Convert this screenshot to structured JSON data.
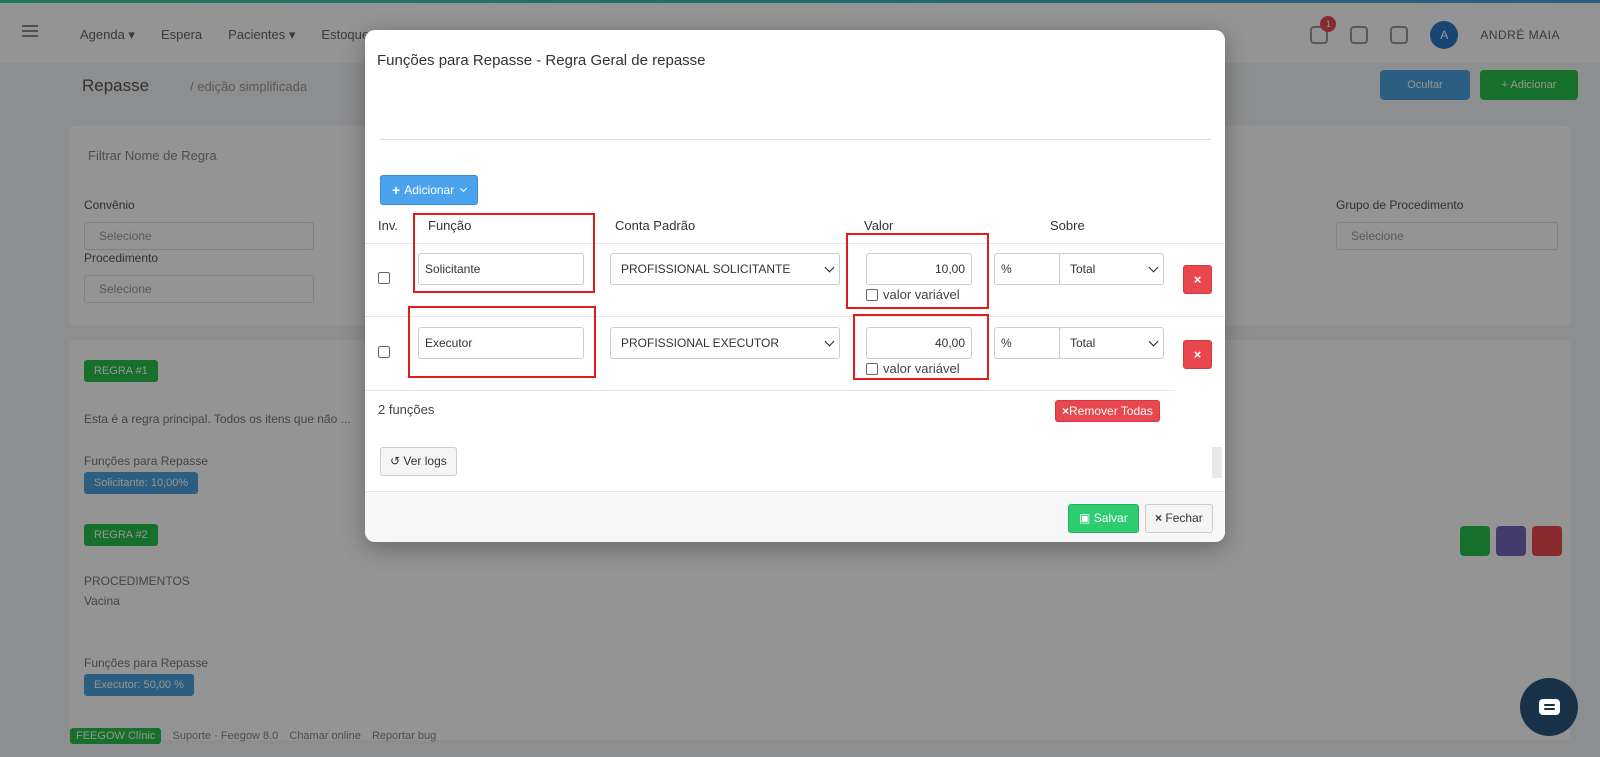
{
  "background": {
    "nav": [
      "Agenda ▾",
      "Espera",
      "Pacientes ▾",
      "Estoque"
    ],
    "user_name": "ANDRÉ MAIA",
    "notifications_count": "1",
    "page_title": "Repasse",
    "page_subtitle": "/ edição simplificada",
    "btn_primary": "Ocultar",
    "btn_success": "+ Adicionar",
    "filter_placeholder": "Filtrar Nome de Regra",
    "labels": {
      "convenio": "Convênio",
      "procedimento": "Procedimento",
      "grupo_procedimento": "Grupo de Procedimento"
    },
    "select_placeholder": "Selecione",
    "tag_rule1": "REGRA #1",
    "rule_text": "Esta é a regra principal. Todos os itens que não ...",
    "funcoes_label": "Funções para Repasse",
    "tag_funcoes": "Solicitante: 10,00%",
    "tag_rule2": "REGRA #2",
    "procedimentos_label": "PROCEDIMENTOS",
    "procedimento_value": "Vacina",
    "tag_funcoes2": "Executor: 50,00 %",
    "footer_items": [
      "FEEGOW Clínic",
      "Suporte · Feegow 8.0",
      "Chamar online",
      "Reportar bug"
    ]
  },
  "modal": {
    "title": "Funções para Repasse - Regra Geral de repasse",
    "add_button": "Adicionar",
    "headers": {
      "inv": "Inv.",
      "funcao": "Função",
      "conta": "Conta Padrão",
      "valor": "Valor",
      "sobre": "Sobre"
    },
    "rows": [
      {
        "funcao": "Solicitante",
        "conta": "PROFISSIONAL SOLICITANTE",
        "valor": "10,00",
        "variavel_label": "valor variável",
        "tipo": "%",
        "sobre": "Total"
      },
      {
        "funcao": "Executor",
        "conta": "PROFISSIONAL EXECUTOR",
        "valor": "40,00",
        "variavel_label": "valor variável",
        "tipo": "%",
        "sobre": "Total"
      }
    ],
    "delete_symbol": "×",
    "count_text": "2 funções",
    "remove_all": "Remover Todas",
    "logs_button": "Ver logs",
    "save_button": "Salvar",
    "close_button": "Fechar"
  }
}
